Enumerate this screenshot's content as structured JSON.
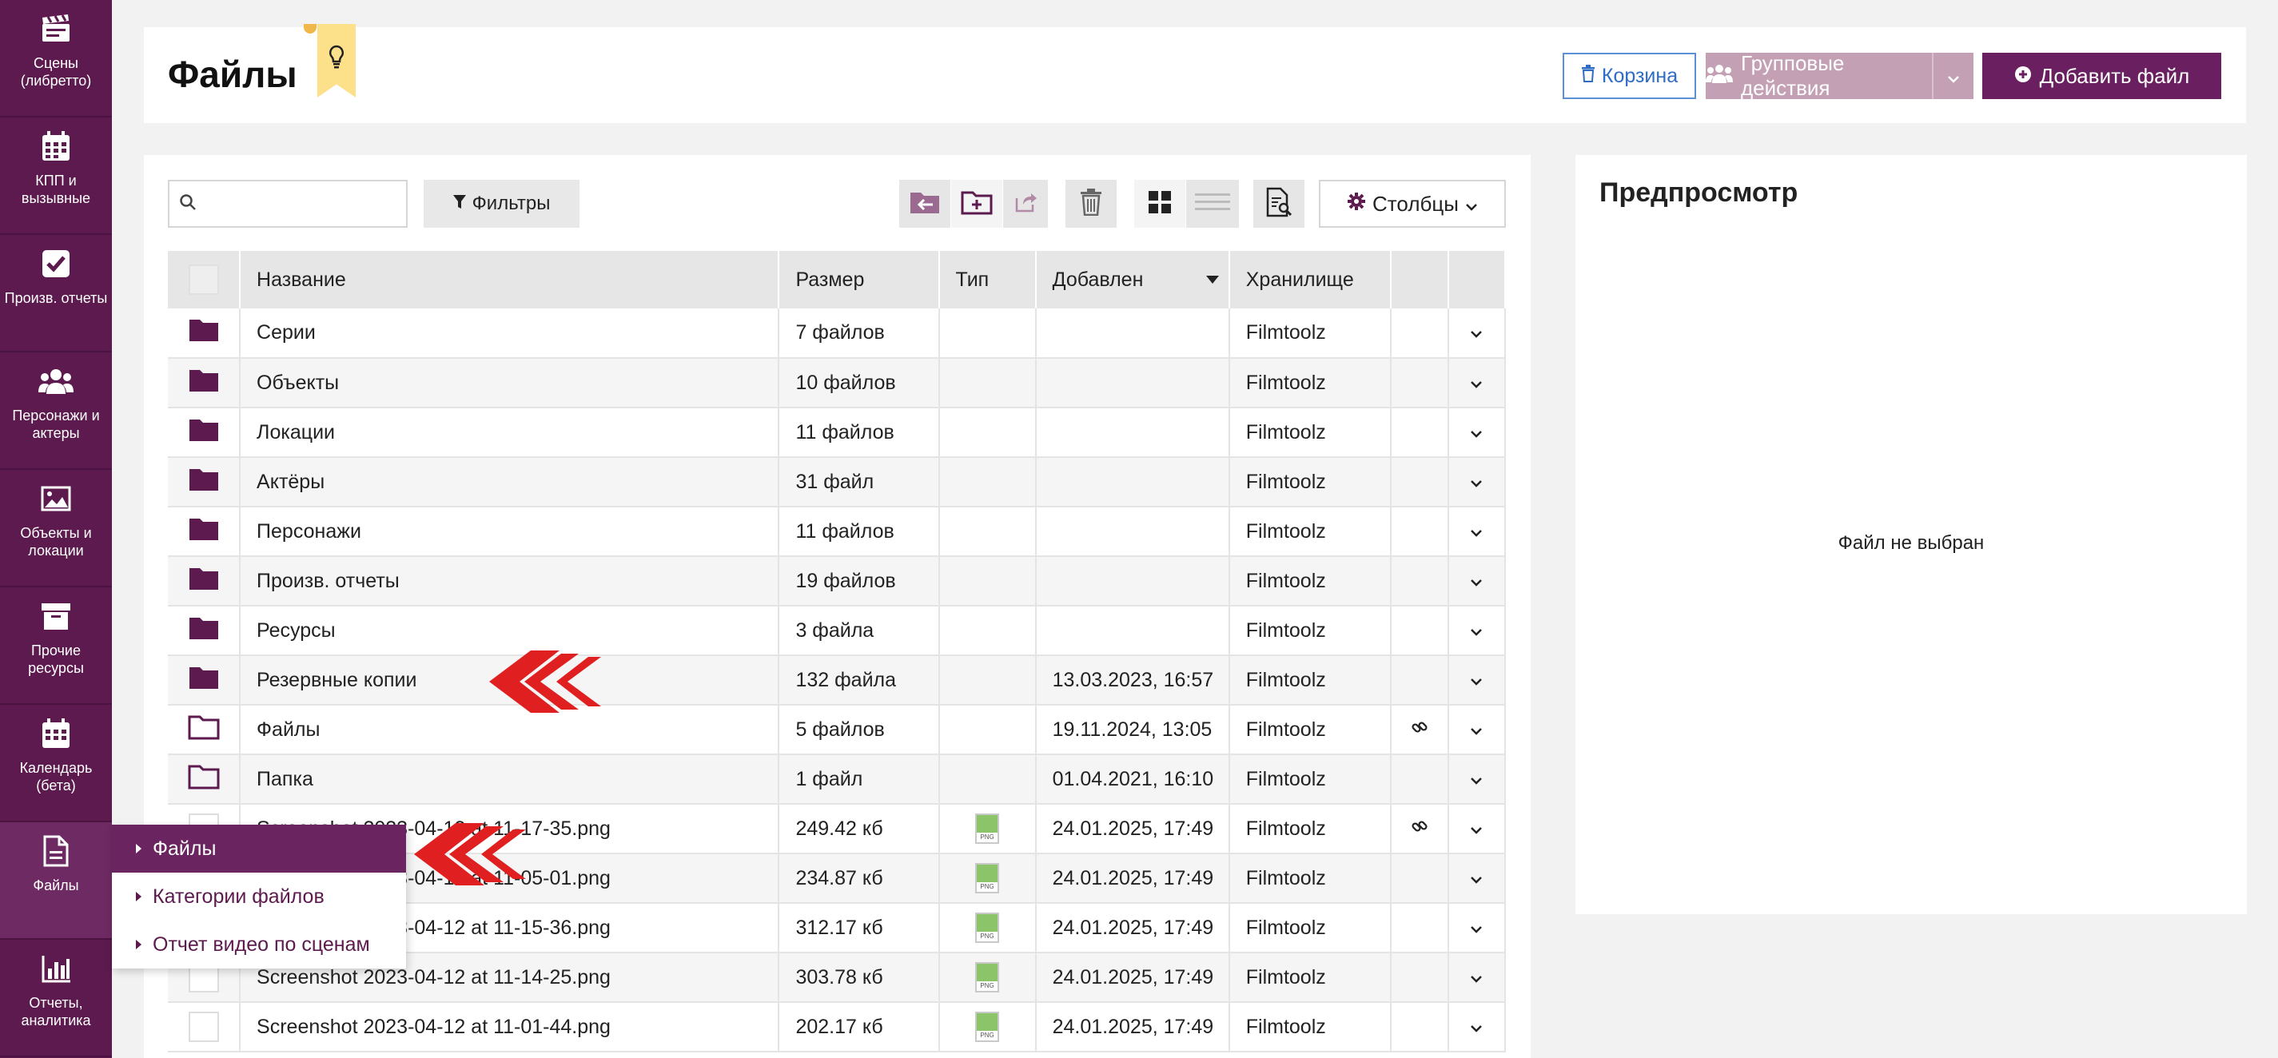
{
  "sidebar": {
    "items": [
      {
        "label": "Сцены (либретто)",
        "icon": "clapperboard-icon"
      },
      {
        "label": "КПП и вызывные",
        "icon": "calendar-grid-icon"
      },
      {
        "label": "Произв. отчеты",
        "icon": "checkbox-icon"
      },
      {
        "label": "Персонажи и актеры",
        "icon": "users-icon"
      },
      {
        "label": "Объекты и локации",
        "icon": "image-icon"
      },
      {
        "label": "Прочие ресурсы",
        "icon": "archive-icon"
      },
      {
        "label": "Календарь (бета)",
        "icon": "calendar-icon"
      },
      {
        "label": "Файлы",
        "icon": "file-icon"
      },
      {
        "label": "Отчеты, аналитика",
        "icon": "bar-chart-icon"
      }
    ]
  },
  "flyout": {
    "items": [
      {
        "label": "Файлы",
        "active": true
      },
      {
        "label": "Категории файлов",
        "active": false
      },
      {
        "label": "Отчет видео по сценам",
        "active": false
      }
    ]
  },
  "header": {
    "title": "Файлы",
    "trash_label": "Корзина",
    "group_actions_label": "Групповые действия",
    "add_file_label": "Добавить файл"
  },
  "toolbar": {
    "search_placeholder": "",
    "filters_label": "Фильтры",
    "columns_label": "Столбцы"
  },
  "table": {
    "columns": [
      "Название",
      "Размер",
      "Тип",
      "Добавлен",
      "Хранилище"
    ],
    "rows": [
      {
        "name": "Серии",
        "size": "7 файлов",
        "type": "folder",
        "added": "",
        "storage": "Filmtoolz",
        "link": false
      },
      {
        "name": "Объекты",
        "size": "10 файлов",
        "type": "folder",
        "added": "",
        "storage": "Filmtoolz",
        "link": false
      },
      {
        "name": "Локации",
        "size": "11 файлов",
        "type": "folder",
        "added": "",
        "storage": "Filmtoolz",
        "link": false
      },
      {
        "name": "Актёры",
        "size": "31 файл",
        "type": "folder",
        "added": "",
        "storage": "Filmtoolz",
        "link": false
      },
      {
        "name": "Персонажи",
        "size": "11 файлов",
        "type": "folder",
        "added": "",
        "storage": "Filmtoolz",
        "link": false
      },
      {
        "name": "Произв. отчеты",
        "size": "19 файлов",
        "type": "folder",
        "added": "",
        "storage": "Filmtoolz",
        "link": false
      },
      {
        "name": "Ресурсы",
        "size": "3 файла",
        "type": "folder",
        "added": "",
        "storage": "Filmtoolz",
        "link": false
      },
      {
        "name": "Резервные копии",
        "size": "132 файла",
        "type": "folder",
        "added": "13.03.2023, 16:57",
        "storage": "Filmtoolz",
        "link": false
      },
      {
        "name": "Файлы",
        "size": "5 файлов",
        "type": "folder-outline",
        "added": "19.11.2024, 13:05",
        "storage": "Filmtoolz",
        "link": true
      },
      {
        "name": "Папка",
        "size": "1 файл",
        "type": "folder-outline",
        "added": "01.04.2021, 16:10",
        "storage": "Filmtoolz",
        "link": false
      },
      {
        "name": "Screenshot 2023-04-12 at 11-17-35.png",
        "size": "249.42 кб",
        "type": "png",
        "added": "24.01.2025, 17:49",
        "storage": "Filmtoolz",
        "link": true
      },
      {
        "name": "Screenshot 2023-04-12 at 11-05-01.png",
        "size": "234.87 кб",
        "type": "png",
        "added": "24.01.2025, 17:49",
        "storage": "Filmtoolz",
        "link": false
      },
      {
        "name": "Screenshot 2023-04-12 at 11-15-36.png",
        "size": "312.17 кб",
        "type": "png",
        "added": "24.01.2025, 17:49",
        "storage": "Filmtoolz",
        "link": false
      },
      {
        "name": "Screenshot 2023-04-12 at 11-14-25.png",
        "size": "303.78 кб",
        "type": "png",
        "added": "24.01.2025, 17:49",
        "storage": "Filmtoolz",
        "link": false
      },
      {
        "name": "Screenshot 2023-04-12 at 11-01-44.png",
        "size": "202.17 кб",
        "type": "png",
        "added": "24.01.2025, 17:49",
        "storage": "Filmtoolz",
        "link": false
      }
    ]
  },
  "preview": {
    "title": "Предпросмотр",
    "empty_text": "Файл не выбран"
  },
  "colors": {
    "sidebar": "#5c1a4e",
    "accent": "#6a2060",
    "folder": "#5c1a4e",
    "arrows": "#e02020",
    "link_button": "#2e6cc5"
  }
}
